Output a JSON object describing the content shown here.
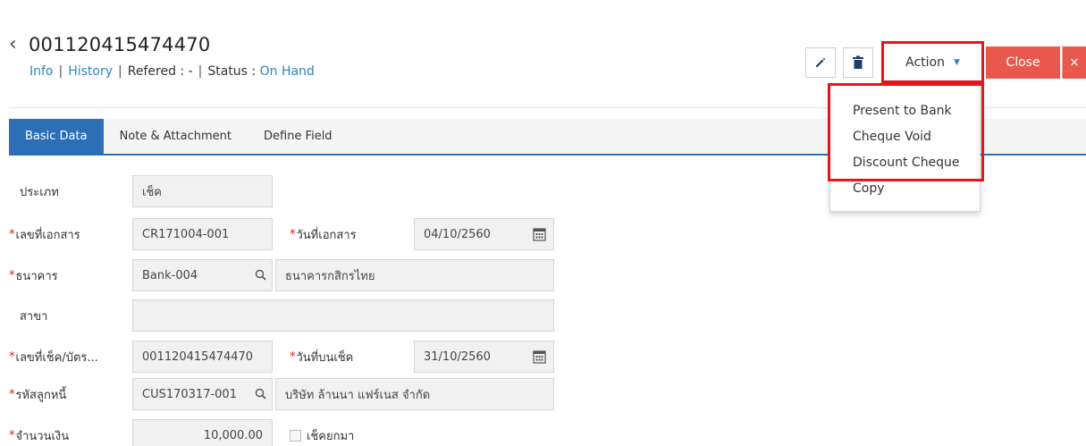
{
  "header": {
    "back_symbol": "‹",
    "doc_number": "001120415474470",
    "subnav": {
      "info": "Info",
      "history": "History",
      "refered_label": "Refered",
      "refered_value": "-",
      "status_label": "Status",
      "status_value": "On Hand",
      "separator": "|",
      "colon": ":"
    }
  },
  "toolbar": {
    "edit_icon": "pencil-icon",
    "delete_icon": "trash-icon",
    "action_label": "Action",
    "close_label": "Close",
    "close_x": "×"
  },
  "action_menu": {
    "items": [
      "Present to Bank",
      "Cheque Void",
      "Discount Cheque",
      "Copy"
    ]
  },
  "tabs": [
    {
      "label": "Basic Data",
      "active": true
    },
    {
      "label": "Note & Attachment",
      "active": false
    },
    {
      "label": "Define Field",
      "active": false
    }
  ],
  "form": {
    "type": {
      "label": "ประเภท",
      "value": "เช็ค"
    },
    "doc_no": {
      "label": "เลขที่เอกสาร",
      "value": "CR171004-001"
    },
    "doc_date": {
      "label": "วันที่เอกสาร",
      "value": "04/10/2560"
    },
    "bank": {
      "label": "ธนาคาร",
      "code": "Bank-004",
      "name": "ธนาคารกสิกรไทย"
    },
    "branch": {
      "label": "สาขา",
      "value": ""
    },
    "cheque_no": {
      "label": "เลขที่เช็ค/บัตร...",
      "value": "001120415474470"
    },
    "cheque_date": {
      "label": "วันที่บนเช็ค",
      "value": "31/10/2560"
    },
    "debtor": {
      "label": "รหัสลูกหนี้",
      "code": "CUS170317-001",
      "name": "บริษัท ล้านนา แฟร์เนส จำกัด"
    },
    "amount": {
      "label": "จำนวนเงิน",
      "value": "10,000.00",
      "check_label": "เช็คยกมา"
    },
    "required_mark": "*"
  },
  "colors": {
    "accent": "#2c6fb7",
    "link": "#2e86c1",
    "close": "#e8584d",
    "highlight": "#e8141c"
  }
}
